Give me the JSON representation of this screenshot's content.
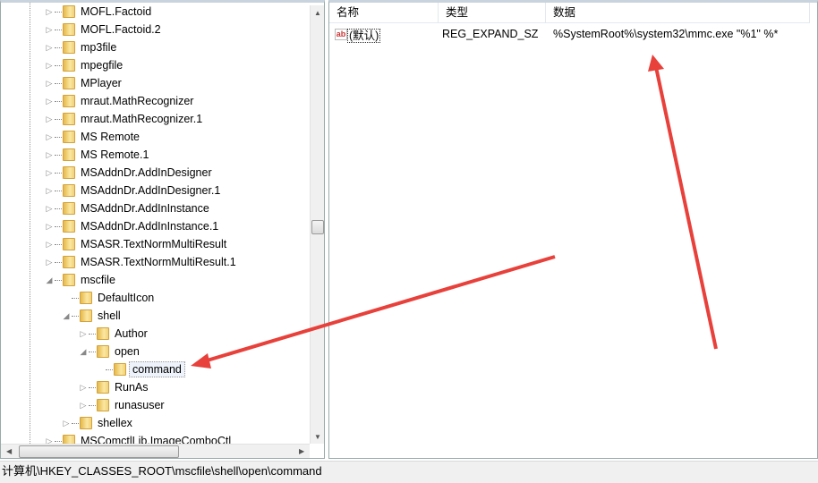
{
  "tree": {
    "items": [
      {
        "label": "MOFL.Factoid",
        "level": 0,
        "expander": "collapsed"
      },
      {
        "label": "MOFL.Factoid.2",
        "level": 0,
        "expander": "collapsed"
      },
      {
        "label": "mp3file",
        "level": 0,
        "expander": "collapsed"
      },
      {
        "label": "mpegfile",
        "level": 0,
        "expander": "collapsed"
      },
      {
        "label": "MPlayer",
        "level": 0,
        "expander": "collapsed"
      },
      {
        "label": "mraut.MathRecognizer",
        "level": 0,
        "expander": "collapsed"
      },
      {
        "label": "mraut.MathRecognizer.1",
        "level": 0,
        "expander": "collapsed"
      },
      {
        "label": "MS Remote",
        "level": 0,
        "expander": "collapsed"
      },
      {
        "label": "MS Remote.1",
        "level": 0,
        "expander": "collapsed"
      },
      {
        "label": "MSAddnDr.AddInDesigner",
        "level": 0,
        "expander": "collapsed"
      },
      {
        "label": "MSAddnDr.AddInDesigner.1",
        "level": 0,
        "expander": "collapsed"
      },
      {
        "label": "MSAddnDr.AddInInstance",
        "level": 0,
        "expander": "collapsed"
      },
      {
        "label": "MSAddnDr.AddInInstance.1",
        "level": 0,
        "expander": "collapsed"
      },
      {
        "label": "MSASR.TextNormMultiResult",
        "level": 0,
        "expander": "collapsed"
      },
      {
        "label": "MSASR.TextNormMultiResult.1",
        "level": 0,
        "expander": "collapsed"
      },
      {
        "label": "mscfile",
        "level": 0,
        "expander": "expanded"
      },
      {
        "label": "DefaultIcon",
        "level": 1,
        "expander": "none"
      },
      {
        "label": "shell",
        "level": 1,
        "expander": "expanded"
      },
      {
        "label": "Author",
        "level": 2,
        "expander": "collapsed"
      },
      {
        "label": "open",
        "level": 2,
        "expander": "expanded"
      },
      {
        "label": "command",
        "level": 3,
        "expander": "none",
        "selected": true
      },
      {
        "label": "RunAs",
        "level": 2,
        "expander": "collapsed"
      },
      {
        "label": "runasuser",
        "level": 2,
        "expander": "collapsed"
      },
      {
        "label": "shellex",
        "level": 1,
        "expander": "collapsed"
      },
      {
        "label": "MSComctlLib.ImageComboCtl",
        "level": 0,
        "expander": "collapsed"
      }
    ]
  },
  "values": {
    "columns": [
      "名称",
      "类型",
      "数据"
    ],
    "rows": [
      {
        "name": "(默认)",
        "type": "REG_EXPAND_SZ",
        "data": "%SystemRoot%\\system32\\mmc.exe \"%1\" %*",
        "icon": "string-value-icon"
      }
    ]
  },
  "status": {
    "path": "计算机\\HKEY_CLASSES_ROOT\\mscfile\\shell\\open\\command"
  },
  "annotation_color": "#e8403a"
}
